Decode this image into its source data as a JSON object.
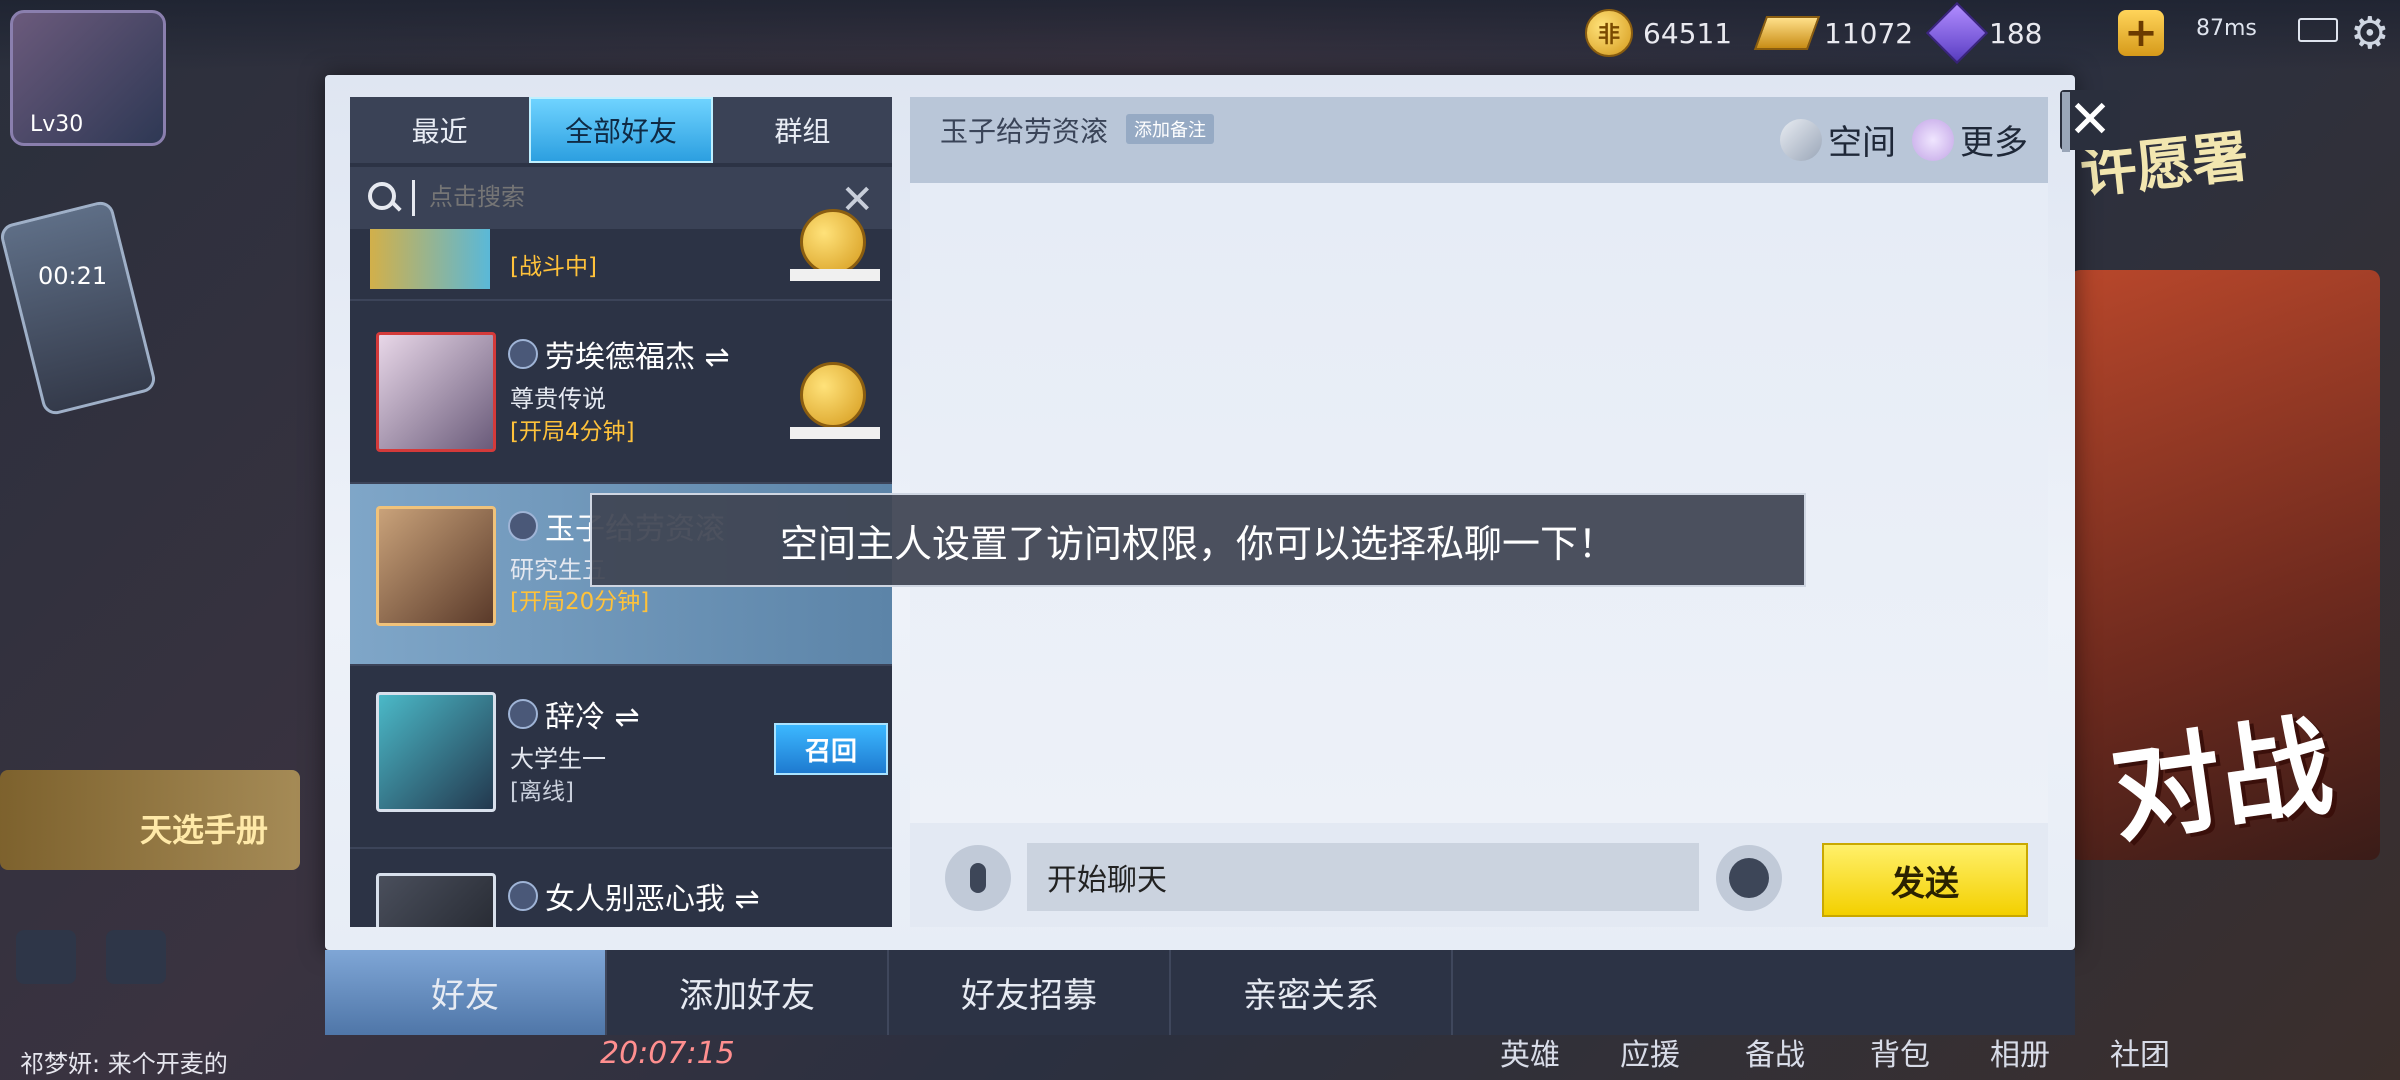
{
  "hud": {
    "level": "Lv30",
    "coins": "64511",
    "gold": "11072",
    "gems": "188",
    "ping": "87ms"
  },
  "background": {
    "left_timer": "00:21",
    "left_book_label": "天选手册",
    "right_poster_label": "对战",
    "right_wish_label": "许愿署",
    "chat_line": "祁梦妍: 来个开麦的",
    "clock": "20:07:15",
    "bottom_nav": [
      "英雄",
      "应援",
      "备战",
      "背包",
      "相册",
      "社团"
    ]
  },
  "friends": {
    "tabs": [
      "最近",
      "全部好友",
      "群组"
    ],
    "active_tab": 1,
    "search_placeholder": "点击搜索",
    "rows": [
      {
        "name": "",
        "subtitle": "",
        "status": "[战斗中]"
      },
      {
        "name": "劳埃德福杰 ⇌",
        "subtitle": "尊贵传说",
        "status": "[开局4分钟]"
      },
      {
        "name": "玉子给劳资滚",
        "subtitle": "研究生五",
        "status": "[开局20分钟]"
      },
      {
        "name": "辞冷 ⇌",
        "subtitle": "大学生一",
        "status": "[离线]",
        "action": "召回"
      },
      {
        "name": "女人别恶心我 ⇌",
        "subtitle": "",
        "status": ""
      }
    ]
  },
  "chat": {
    "title": "玉子给劳资滚",
    "note_tag": "添加备注",
    "space_label": "空间",
    "more_label": "更多",
    "toast": "空间主人设置了访问权限，你可以选择私聊一下！",
    "input_value": "开始聊天",
    "send_label": "发送",
    "close_label": "✕"
  },
  "bottom_tabs": [
    "好友",
    "添加好友",
    "好友招募",
    "亲密关系"
  ],
  "colors": {
    "accent_tab": "#2c9fe0",
    "send_yellow": "#f3d000",
    "status_orange": "#ffc23a"
  }
}
